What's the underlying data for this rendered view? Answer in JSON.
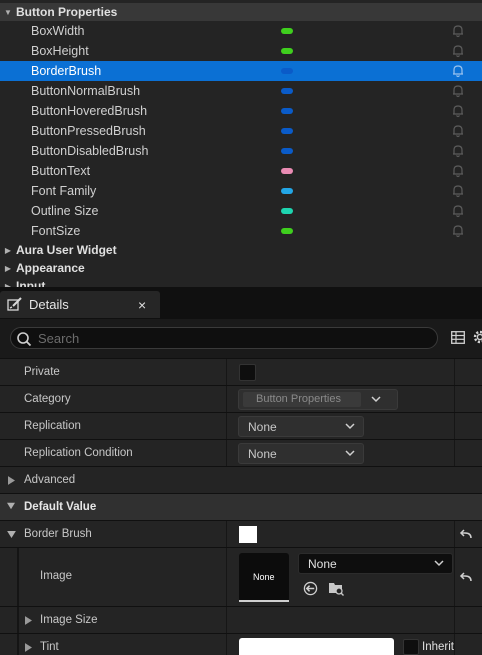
{
  "variables_panel": {
    "category_title": "Button Properties",
    "variables": [
      {
        "name": "BoxWidth",
        "color": "#3fcf1e",
        "selected": false
      },
      {
        "name": "BoxHeight",
        "color": "#3fcf1e",
        "selected": false
      },
      {
        "name": "BorderBrush",
        "color": "#0a5bc8",
        "selected": true
      },
      {
        "name": "ButtonNormalBrush",
        "color": "#0a5bc8",
        "selected": false
      },
      {
        "name": "ButtonHoveredBrush",
        "color": "#0a5bc8",
        "selected": false
      },
      {
        "name": "ButtonPressedBrush",
        "color": "#0a5bc8",
        "selected": false
      },
      {
        "name": "ButtonDisabledBrush",
        "color": "#0a5bc8",
        "selected": false
      },
      {
        "name": "ButtonText",
        "color": "#e98bb3",
        "selected": false
      },
      {
        "name": "Font Family",
        "color": "#23a6e6",
        "selected": false
      },
      {
        "name": "Outline Size",
        "color": "#1ed4b0",
        "selected": false
      },
      {
        "name": "FontSize",
        "color": "#3fcf1e",
        "selected": false
      }
    ],
    "other_categories": [
      "Aura User Widget",
      "Appearance",
      "Input"
    ]
  },
  "details": {
    "tab_label": "Details",
    "tab_close": "×",
    "search_placeholder": "Search",
    "private_label": "Private",
    "category_label": "Category",
    "category_value": "Button Properties",
    "replication_label": "Replication",
    "replication_value": "None",
    "replication_condition_label": "Replication Condition",
    "replication_condition_value": "None",
    "advanced_label": "Advanced",
    "default_value_label": "Default Value",
    "border_brush_label": "Border Brush",
    "image_label": "Image",
    "image_thumb_text": "None",
    "image_asset_value": "None",
    "image_size_label": "Image Size",
    "tint_label": "Tint",
    "inherit_label": "Inherit"
  },
  "colors": {
    "selection": "#0b70d4",
    "panel": "#242424"
  }
}
